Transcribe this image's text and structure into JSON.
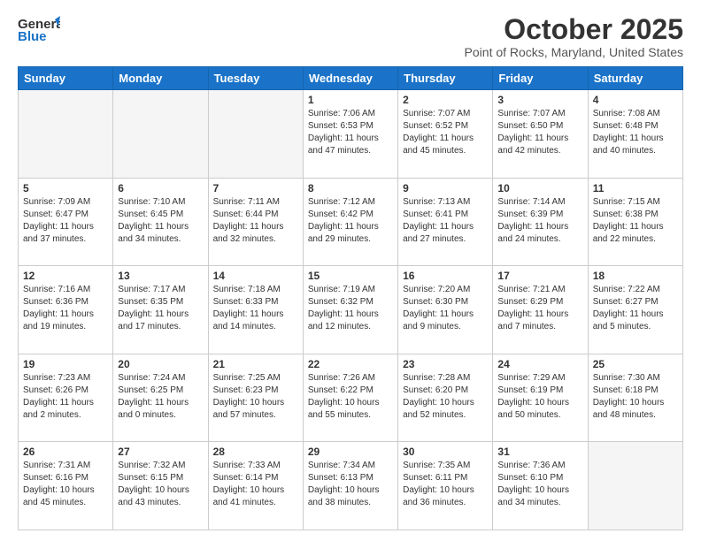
{
  "logo": {
    "line1": "General",
    "line2": "Blue"
  },
  "header": {
    "month": "October 2025",
    "location": "Point of Rocks, Maryland, United States"
  },
  "days_of_week": [
    "Sunday",
    "Monday",
    "Tuesday",
    "Wednesday",
    "Thursday",
    "Friday",
    "Saturday"
  ],
  "weeks": [
    [
      {
        "day": "",
        "info": ""
      },
      {
        "day": "",
        "info": ""
      },
      {
        "day": "",
        "info": ""
      },
      {
        "day": "1",
        "info": "Sunrise: 7:06 AM\nSunset: 6:53 PM\nDaylight: 11 hours and 47 minutes."
      },
      {
        "day": "2",
        "info": "Sunrise: 7:07 AM\nSunset: 6:52 PM\nDaylight: 11 hours and 45 minutes."
      },
      {
        "day": "3",
        "info": "Sunrise: 7:07 AM\nSunset: 6:50 PM\nDaylight: 11 hours and 42 minutes."
      },
      {
        "day": "4",
        "info": "Sunrise: 7:08 AM\nSunset: 6:48 PM\nDaylight: 11 hours and 40 minutes."
      }
    ],
    [
      {
        "day": "5",
        "info": "Sunrise: 7:09 AM\nSunset: 6:47 PM\nDaylight: 11 hours and 37 minutes."
      },
      {
        "day": "6",
        "info": "Sunrise: 7:10 AM\nSunset: 6:45 PM\nDaylight: 11 hours and 34 minutes."
      },
      {
        "day": "7",
        "info": "Sunrise: 7:11 AM\nSunset: 6:44 PM\nDaylight: 11 hours and 32 minutes."
      },
      {
        "day": "8",
        "info": "Sunrise: 7:12 AM\nSunset: 6:42 PM\nDaylight: 11 hours and 29 minutes."
      },
      {
        "day": "9",
        "info": "Sunrise: 7:13 AM\nSunset: 6:41 PM\nDaylight: 11 hours and 27 minutes."
      },
      {
        "day": "10",
        "info": "Sunrise: 7:14 AM\nSunset: 6:39 PM\nDaylight: 11 hours and 24 minutes."
      },
      {
        "day": "11",
        "info": "Sunrise: 7:15 AM\nSunset: 6:38 PM\nDaylight: 11 hours and 22 minutes."
      }
    ],
    [
      {
        "day": "12",
        "info": "Sunrise: 7:16 AM\nSunset: 6:36 PM\nDaylight: 11 hours and 19 minutes."
      },
      {
        "day": "13",
        "info": "Sunrise: 7:17 AM\nSunset: 6:35 PM\nDaylight: 11 hours and 17 minutes."
      },
      {
        "day": "14",
        "info": "Sunrise: 7:18 AM\nSunset: 6:33 PM\nDaylight: 11 hours and 14 minutes."
      },
      {
        "day": "15",
        "info": "Sunrise: 7:19 AM\nSunset: 6:32 PM\nDaylight: 11 hours and 12 minutes."
      },
      {
        "day": "16",
        "info": "Sunrise: 7:20 AM\nSunset: 6:30 PM\nDaylight: 11 hours and 9 minutes."
      },
      {
        "day": "17",
        "info": "Sunrise: 7:21 AM\nSunset: 6:29 PM\nDaylight: 11 hours and 7 minutes."
      },
      {
        "day": "18",
        "info": "Sunrise: 7:22 AM\nSunset: 6:27 PM\nDaylight: 11 hours and 5 minutes."
      }
    ],
    [
      {
        "day": "19",
        "info": "Sunrise: 7:23 AM\nSunset: 6:26 PM\nDaylight: 11 hours and 2 minutes."
      },
      {
        "day": "20",
        "info": "Sunrise: 7:24 AM\nSunset: 6:25 PM\nDaylight: 11 hours and 0 minutes."
      },
      {
        "day": "21",
        "info": "Sunrise: 7:25 AM\nSunset: 6:23 PM\nDaylight: 10 hours and 57 minutes."
      },
      {
        "day": "22",
        "info": "Sunrise: 7:26 AM\nSunset: 6:22 PM\nDaylight: 10 hours and 55 minutes."
      },
      {
        "day": "23",
        "info": "Sunrise: 7:28 AM\nSunset: 6:20 PM\nDaylight: 10 hours and 52 minutes."
      },
      {
        "day": "24",
        "info": "Sunrise: 7:29 AM\nSunset: 6:19 PM\nDaylight: 10 hours and 50 minutes."
      },
      {
        "day": "25",
        "info": "Sunrise: 7:30 AM\nSunset: 6:18 PM\nDaylight: 10 hours and 48 minutes."
      }
    ],
    [
      {
        "day": "26",
        "info": "Sunrise: 7:31 AM\nSunset: 6:16 PM\nDaylight: 10 hours and 45 minutes."
      },
      {
        "day": "27",
        "info": "Sunrise: 7:32 AM\nSunset: 6:15 PM\nDaylight: 10 hours and 43 minutes."
      },
      {
        "day": "28",
        "info": "Sunrise: 7:33 AM\nSunset: 6:14 PM\nDaylight: 10 hours and 41 minutes."
      },
      {
        "day": "29",
        "info": "Sunrise: 7:34 AM\nSunset: 6:13 PM\nDaylight: 10 hours and 38 minutes."
      },
      {
        "day": "30",
        "info": "Sunrise: 7:35 AM\nSunset: 6:11 PM\nDaylight: 10 hours and 36 minutes."
      },
      {
        "day": "31",
        "info": "Sunrise: 7:36 AM\nSunset: 6:10 PM\nDaylight: 10 hours and 34 minutes."
      },
      {
        "day": "",
        "info": ""
      }
    ]
  ]
}
